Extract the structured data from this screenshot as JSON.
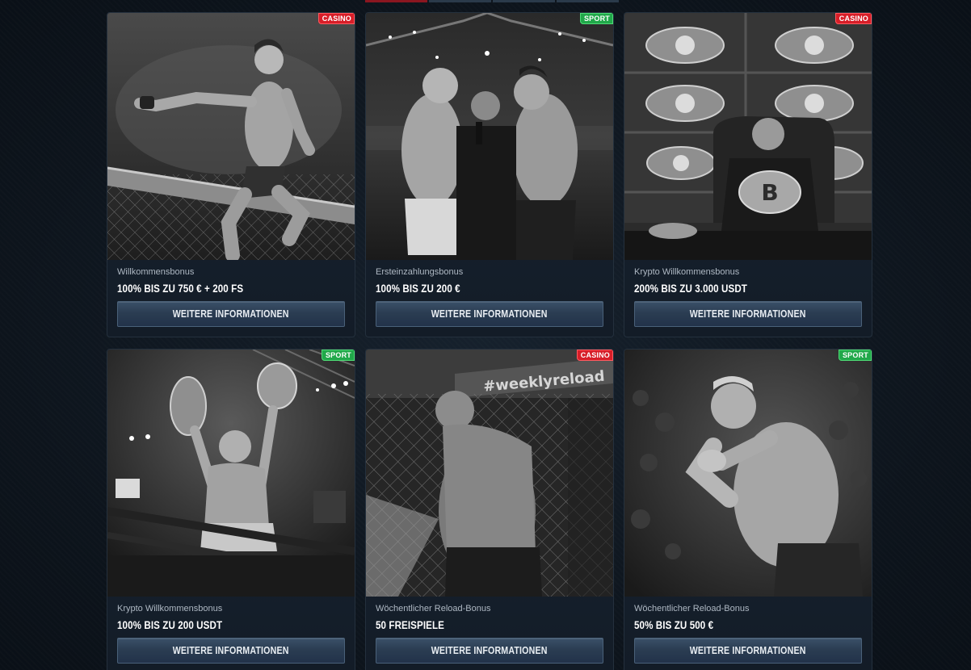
{
  "nav": {
    "tabs": [
      "",
      "",
      "",
      ""
    ]
  },
  "colors": {
    "casino_badge": "#d71e28",
    "sport_badge": "#21a84a",
    "button": "#2b3d52",
    "card": "#1a2634"
  },
  "cards": [
    {
      "badge": "CASINO",
      "badge_type": "casino",
      "image": "fighter-celebrating-on-cage-photo",
      "bonus_type": "Willkommensbonus",
      "bonus_value": "100% BIS ZU 750 € + 200 FS",
      "button": "WEITERE INFORMATIONEN"
    },
    {
      "badge": "SPORT",
      "badge_type": "sport",
      "image": "fighters-faceoff-with-referee-photo",
      "bonus_type": "Ersteinzahlungsbonus",
      "bonus_value": "100% BIS ZU 200 €",
      "button": "WEITERE INFORMATIONEN"
    },
    {
      "badge": "CASINO",
      "badge_type": "casino",
      "image": "fighter-with-crypto-belts-photo",
      "bonus_type": "Krypto Willkommensbonus",
      "bonus_value": "200% BIS ZU 3.000 USDT",
      "button": "WEITERE INFORMATIONEN"
    },
    {
      "badge": "SPORT",
      "badge_type": "sport",
      "image": "fighter-holding-two-belts-photo",
      "bonus_type": "Krypto Willkommensbonus",
      "bonus_value": "100% BIS ZU 200 USDT",
      "button": "WEITERE INFORMATIONEN"
    },
    {
      "badge": "CASINO",
      "badge_type": "casino",
      "image": "fighter-in-cage-weeklyreload-photo",
      "bonus_type": "Wöchentlicher Reload-Bonus",
      "bonus_value": "50 FREISPIELE",
      "button": "WEITERE INFORMATIONEN"
    },
    {
      "badge": "SPORT",
      "badge_type": "sport",
      "image": "fighter-guard-stance-photo",
      "bonus_type": "Wöchentlicher Reload-Bonus",
      "bonus_value": "50% BIS ZU 500 €",
      "button": "WEITERE INFORMATIONEN"
    }
  ],
  "image_text": {
    "weekly_reload_sign": "#weeklyreload"
  }
}
